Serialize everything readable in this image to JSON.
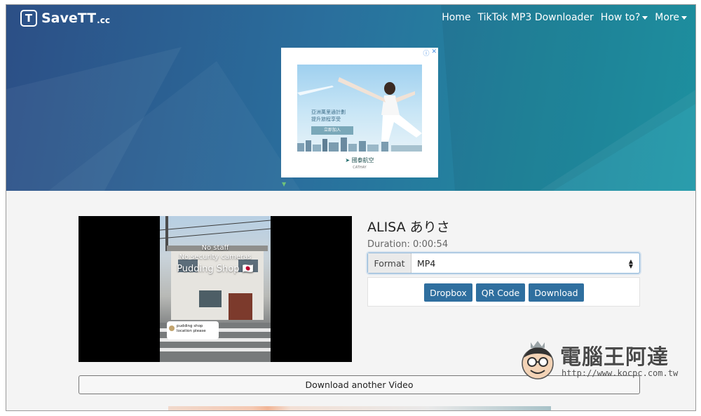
{
  "brand": {
    "logo_letter": "T",
    "name": "SaveTT",
    "suffix": ".cc"
  },
  "nav": {
    "items": [
      {
        "label": "Home",
        "dropdown": false
      },
      {
        "label": "TikTok MP3 Downloader",
        "dropdown": false
      },
      {
        "label": "How to?",
        "dropdown": true
      },
      {
        "label": "More",
        "dropdown": true
      }
    ]
  },
  "ad": {
    "icons": [
      "info-icon",
      "close-icon"
    ],
    "headline_1": "亞洲萬里通計劃",
    "headline_2": "提升旅程享受",
    "cta": "立即加入",
    "brand": "國泰航空",
    "brand_sub": "CATHAY"
  },
  "video": {
    "overlay_line_1": "No staff",
    "overlay_line_2": "No security cameras",
    "overlay_line_3": "Pudding Shop 🇯🇵",
    "comment": "pudding shop location please"
  },
  "result": {
    "title": "ALISA ありさ",
    "duration": "Duration: 0:00:54",
    "format_label": "Format",
    "format_value": "MP4",
    "buttons": {
      "dropbox": "Dropbox",
      "qr": "QR Code",
      "download": "Download"
    },
    "another": "Download another Video"
  },
  "watermark": {
    "text": "電腦王阿達",
    "url": "http://www.kocpc.com.tw"
  },
  "colors": {
    "hero_start": "#2c4f86",
    "hero_end": "#1f98a8",
    "button": "#2f6f9f"
  }
}
